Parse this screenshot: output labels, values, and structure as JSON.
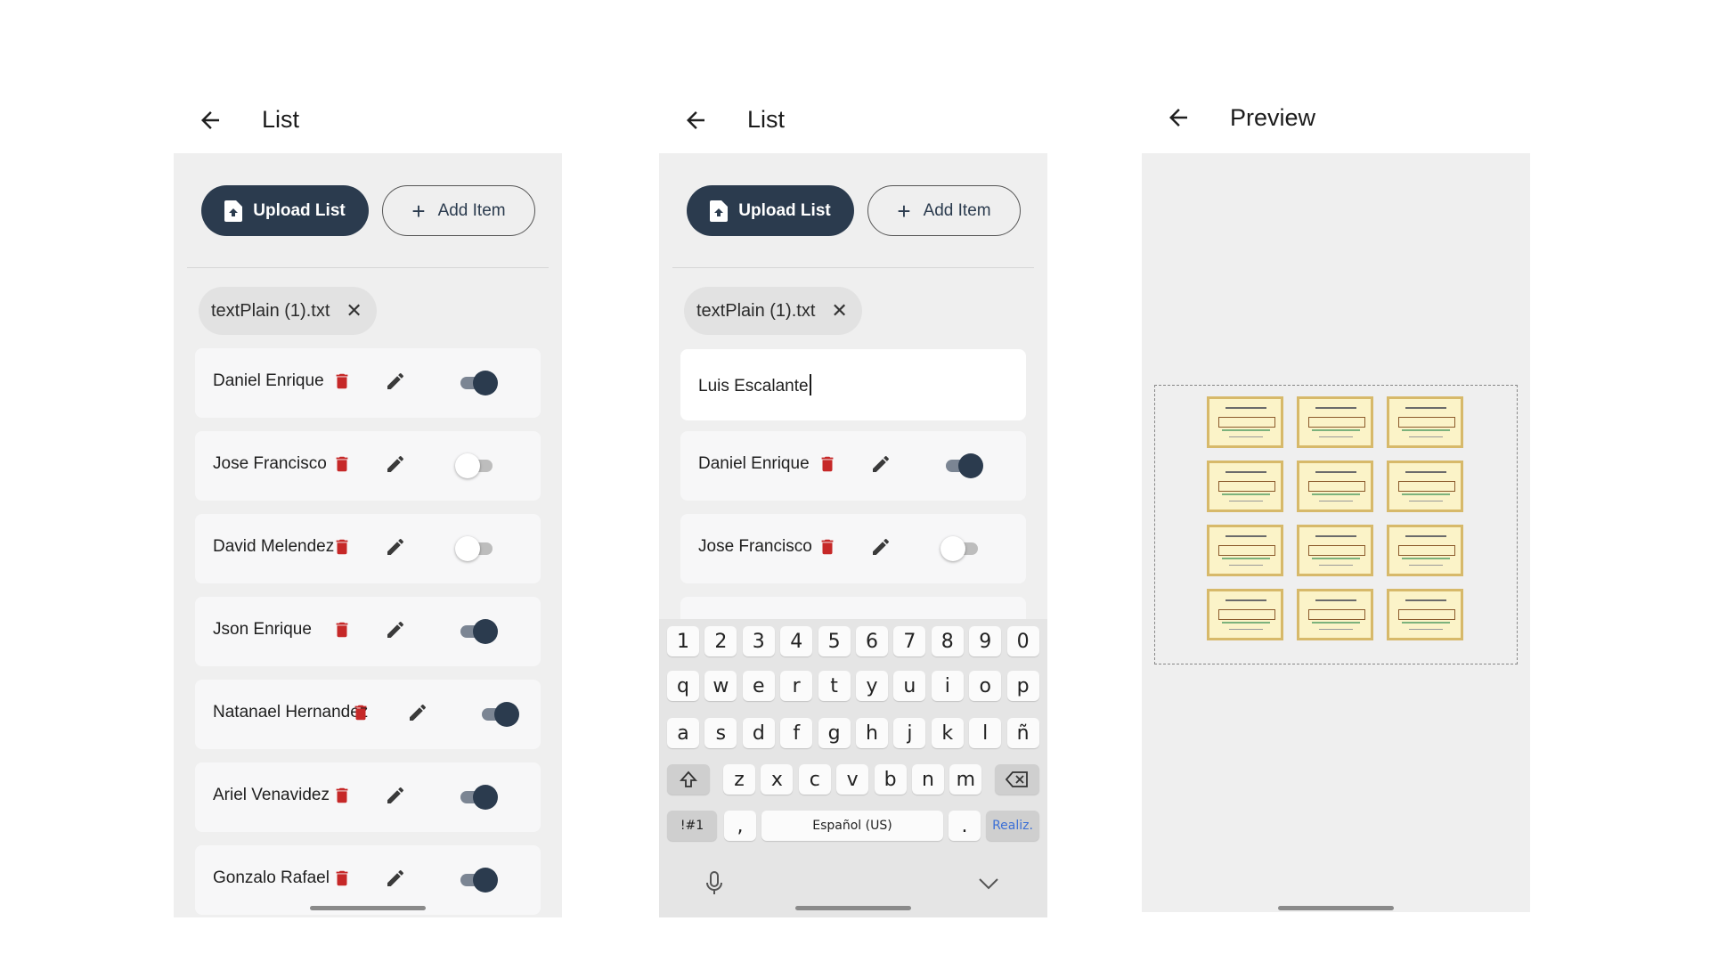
{
  "screens": {
    "list1": {
      "title": "List",
      "upload_label": "Upload List",
      "add_label": "Add Item",
      "chip_label": "textPlain (1).txt",
      "items": [
        {
          "name": "Daniel Enrique",
          "enabled": true
        },
        {
          "name": "Jose Francisco",
          "enabled": false
        },
        {
          "name": "David Melendez",
          "enabled": false
        },
        {
          "name": "Json Enrique",
          "enabled": true
        },
        {
          "name": "Natanael Hernandez",
          "enabled": true
        },
        {
          "name": "Ariel Venavidez",
          "enabled": true
        },
        {
          "name": "Gonzalo Rafael",
          "enabled": true
        }
      ]
    },
    "list2": {
      "title": "List",
      "upload_label": "Upload List",
      "add_label": "Add Item",
      "chip_label": "textPlain (1).txt",
      "input_value": "Luis Escalante",
      "items": [
        {
          "name": "Daniel Enrique",
          "enabled": true
        },
        {
          "name": "Jose Francisco",
          "enabled": false
        }
      ]
    },
    "preview": {
      "title": "Preview",
      "certificate_count": 12
    }
  },
  "keyboard": {
    "row_numbers": [
      "1",
      "2",
      "3",
      "4",
      "5",
      "6",
      "7",
      "8",
      "9",
      "0"
    ],
    "row_top": [
      "q",
      "w",
      "e",
      "r",
      "t",
      "y",
      "u",
      "i",
      "o",
      "p"
    ],
    "row_mid": [
      "a",
      "s",
      "d",
      "f",
      "g",
      "h",
      "j",
      "k",
      "l",
      "ñ"
    ],
    "row_bottom": [
      "z",
      "x",
      "c",
      "v",
      "b",
      "n",
      "m"
    ],
    "symbols_key": "!#1",
    "comma_key": ",",
    "space_label": "Español (US)",
    "period_key": ".",
    "done_label": "Realiz."
  },
  "colors": {
    "primary": "#2b3b4e",
    "delete": "#c62828",
    "panel_bg": "#efefef"
  },
  "icons": [
    "back-arrow-icon",
    "file-upload-icon",
    "plus-icon",
    "close-icon",
    "trash-icon",
    "pencil-icon",
    "shift-icon",
    "backspace-icon",
    "microphone-icon",
    "chevron-down-icon"
  ]
}
